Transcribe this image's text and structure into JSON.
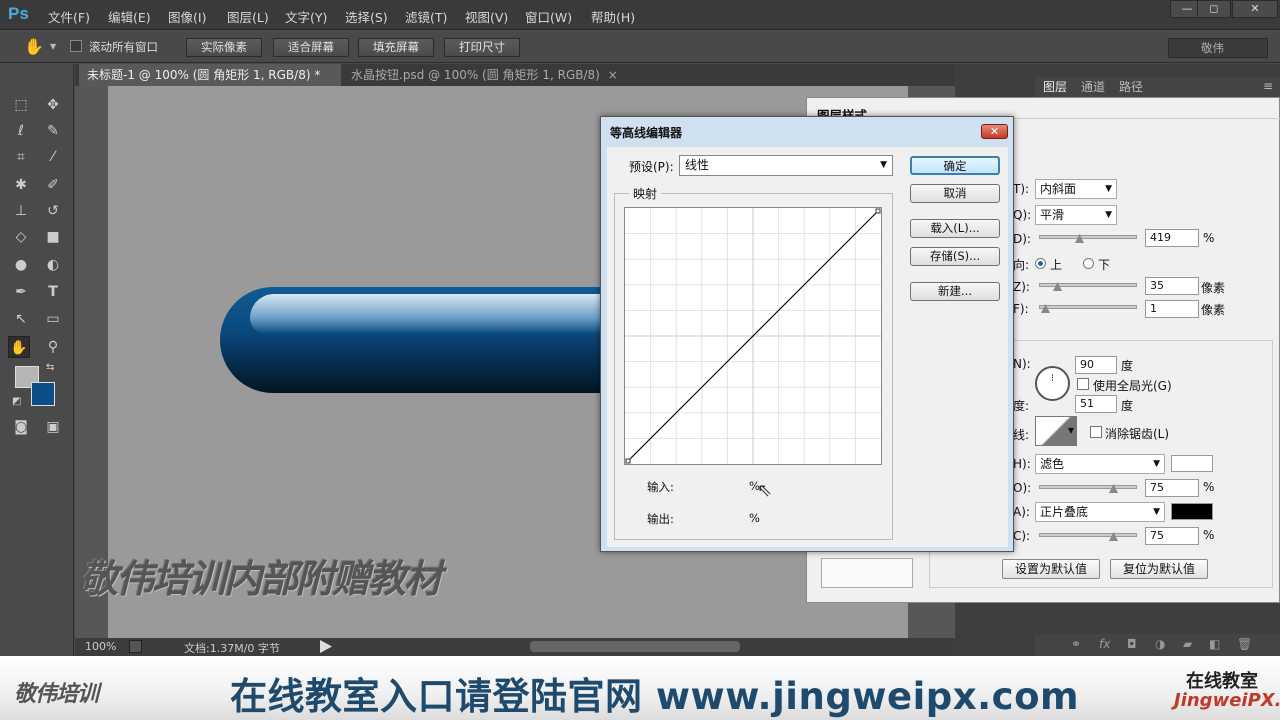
{
  "app": {
    "logo": "Ps"
  },
  "menu": [
    "文件(F)",
    "编辑(E)",
    "图像(I)",
    "图层(L)",
    "文字(Y)",
    "选择(S)",
    "滤镜(T)",
    "视图(V)",
    "窗口(W)",
    "帮助(H)"
  ],
  "window_controls": {
    "minimize": "—",
    "restore": "◻",
    "close": "✕"
  },
  "options": {
    "scroll_all_label": "滚动所有窗口",
    "buttons": [
      "实际像素",
      "适合屏幕",
      "填充屏幕",
      "打印尺寸"
    ],
    "workspace": "敬伟"
  },
  "tabs": [
    {
      "label": "未标题-1 @ 100% (圆 角矩形 1, RGB/8) *",
      "close": "×"
    },
    {
      "label": "水晶按钮.psd @ 100% (圆 角矩形 1, RGB/8)",
      "close": "×"
    }
  ],
  "watermark": "敬伟培训内部附赠教材",
  "status": {
    "zoom": "100%",
    "doc": "文档:1.37M/0 字节"
  },
  "panel_tabs": [
    "图层",
    "通道",
    "路径"
  ],
  "layer_style": {
    "title": "图层样式",
    "style_label": "T):",
    "style_value": "内斜面",
    "technique_label": "Q):",
    "technique_value": "平滑",
    "depth_label": "D):",
    "depth_value": "419",
    "pct": "%",
    "direction_label": "向:",
    "dir_up": "上",
    "dir_down": "下",
    "size_label": "Z):",
    "size_value": "35",
    "soften_label": "F):",
    "soften_value": "1",
    "px": "像素",
    "angle_label": "N):",
    "angle_value": "90",
    "deg": "度",
    "global_light": "使用全局光(G)",
    "altitude_label": "度:",
    "altitude_value": "51",
    "gloss_label": "线:",
    "anti_alias": "消除锯齿(L)",
    "highlight_label": "H):",
    "highlight_mode": "滤色",
    "highlight_color": "#ffffff",
    "hl_opacity_label": "O):",
    "hl_opacity": "75",
    "shadow_label": "A):",
    "shadow_mode": "正片叠底",
    "shadow_color": "#000000",
    "sh_opacity_label": "C):",
    "sh_opacity": "75",
    "make_default": "设置为默认值",
    "reset_default": "复位为默认值"
  },
  "contour": {
    "title": "等高线编辑器",
    "close": "✕",
    "preset_label": "预设(P):",
    "preset_value": "线性",
    "mapping": "映射",
    "ok": "确定",
    "cancel": "取消",
    "load": "载入(L)...",
    "save": "存储(S)...",
    "new": "新建...",
    "input_label": "输入:",
    "input_pct": "%",
    "output_label": "输出:",
    "output_pct": "%"
  },
  "footer": {
    "brand": "敬伟培训",
    "text": "在线教室入口请登陆官网 www.jingweipx.com",
    "right1": "在线教室",
    "right2": "JingweiPX.com"
  },
  "colors": {
    "foreground": "#b5b5b5",
    "background": "#0b4f8a",
    "ps_blue": "#4fa9e6"
  }
}
